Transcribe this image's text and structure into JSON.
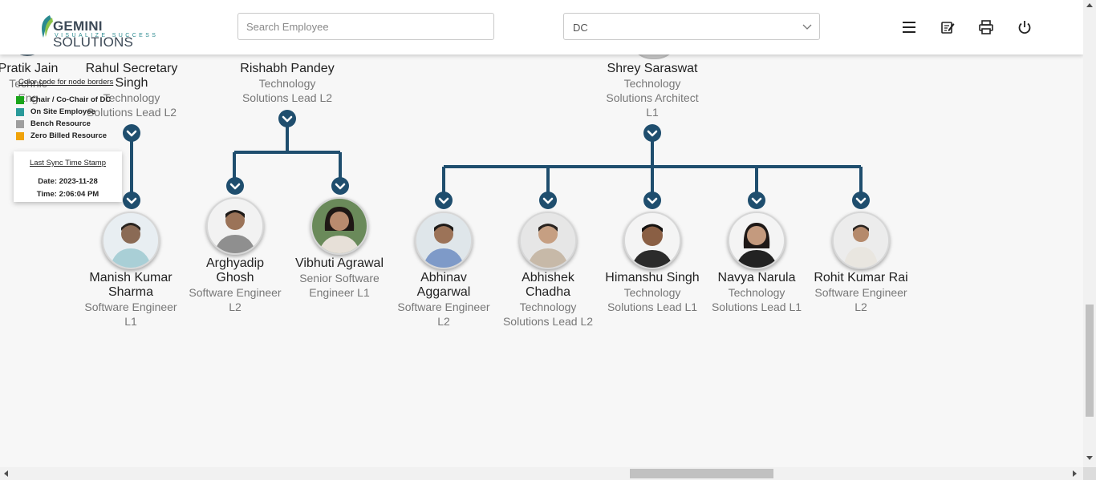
{
  "header": {
    "logo_brand_bold": "GEMINI",
    "logo_brand_rest": " SOLUTIONS",
    "logo_tagline": "VISUALIZE SUCCESS",
    "search_placeholder": "Search Employee",
    "dc_selected": "DC",
    "icons": [
      "menu-icon",
      "edit-note-icon",
      "print-icon",
      "power-icon"
    ]
  },
  "legend": {
    "title": "Color code for node borders",
    "items": [
      {
        "label": "Chair / Co-Chair of DC",
        "color": "#1aa51a"
      },
      {
        "label": "On Site Employee",
        "color": "#2a9a9a"
      },
      {
        "label": "Bench Resource",
        "color": "#9e9e9e"
      },
      {
        "label": "Zero Billed Resource",
        "color": "#f0a30a"
      }
    ]
  },
  "sync": {
    "title": "Last Sync Time Stamp",
    "date": "Date: 2023-11-28",
    "time": "Time: 2:06:04 PM"
  },
  "top_nodes": [
    {
      "name": "Pratik Jain",
      "line1": "Technic",
      "line2": "Eng"
    },
    {
      "name": "Rahul Secretary",
      "name2": "Singh",
      "line1": "Technology",
      "line2": "Solutions Lead L2"
    },
    {
      "name": "Rishabh Pandey",
      "line1": "Technology",
      "line2": "Solutions Lead L2"
    },
    {
      "name": "Shrey Saraswat",
      "line1": "Technology",
      "line2": "Solutions Architect",
      "line3": "L1"
    }
  ],
  "nodes": [
    {
      "name1": "Manish Kumar",
      "name2": "Sharma",
      "d1": "Software Engineer",
      "d2": "L1"
    },
    {
      "name1": "Arghyadip",
      "name2": "Ghosh",
      "d1": "Software Engineer",
      "d2": "L2"
    },
    {
      "name1": "Vibhuti Agrawal",
      "name2": "",
      "d1": "Senior Software",
      "d2": "Engineer L1"
    },
    {
      "name1": "Abhinav",
      "name2": "Aggarwal",
      "d1": "Software Engineer",
      "d2": "L2"
    },
    {
      "name1": "Abhishek",
      "name2": "Chadha",
      "d1": "Technology",
      "d2": "Solutions Lead L2"
    },
    {
      "name1": "Himanshu Singh",
      "name2": "",
      "d1": "Technology",
      "d2": "Solutions Lead L1"
    },
    {
      "name1": "Navya Narula",
      "name2": "",
      "d1": "Technology",
      "d2": "Solutions Lead L1"
    },
    {
      "name1": "Rohit Kumar Rai",
      "name2": "",
      "d1": "Software Engineer",
      "d2": "L2"
    }
  ],
  "colors": {
    "connector": "#1f4e6e",
    "accent": "#2a8a8f"
  }
}
